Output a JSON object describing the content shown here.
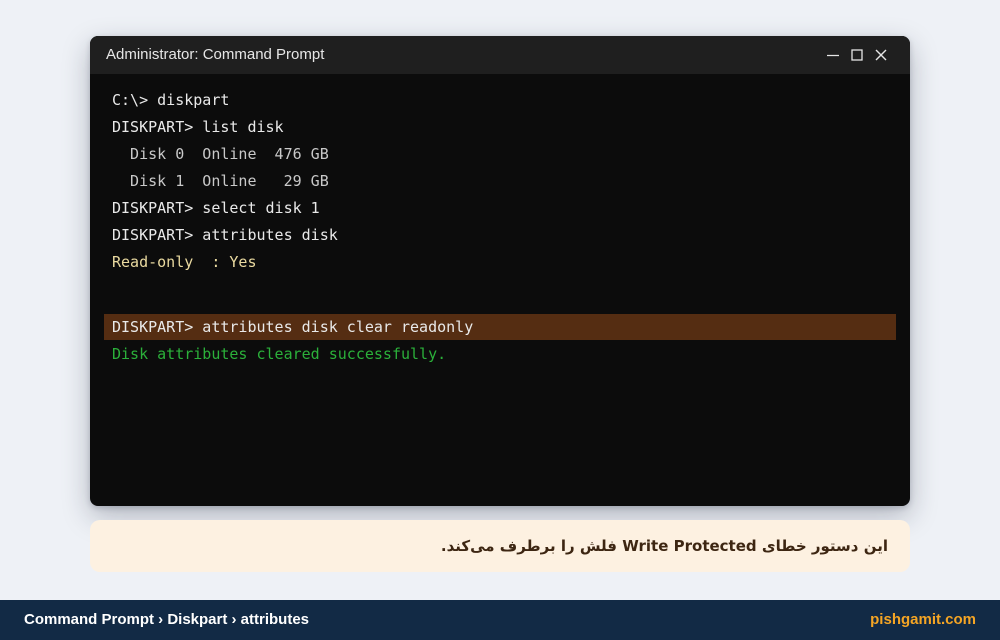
{
  "window": {
    "title": "Administrator: Command Prompt",
    "controls": [
      "minimize-icon",
      "maximize-icon",
      "close-icon"
    ]
  },
  "console": {
    "lines": [
      {
        "text": "C:\\> diskpart",
        "kind": "command"
      },
      {
        "text": "DISKPART> list disk",
        "kind": "command"
      },
      {
        "text": "  Disk 0  Online  476 GB",
        "kind": "output"
      },
      {
        "text": "  Disk 1  Online   29 GB",
        "kind": "output"
      },
      {
        "text": "DISKPART> select disk 1",
        "kind": "command"
      },
      {
        "text": "DISKPART> attributes disk",
        "kind": "command"
      },
      {
        "text": "Read-only  : Yes",
        "kind": "attribute"
      },
      {
        "text": "DISKPART> attributes disk clear readonly",
        "kind": "command-highlighted"
      },
      {
        "text": "Disk attributes cleared successfully.",
        "kind": "success"
      }
    ]
  },
  "caption": {
    "text": "این دستور خطای Write Protected فلش را برطرف می‌کند."
  },
  "footer": {
    "breadcrumb": "Command Prompt › Diskpart › attributes",
    "site": "pishgamit.com"
  },
  "colors": {
    "page_background": "#eef1f6",
    "terminal_background": "#0c0c0c",
    "titlebar_background": "#1f1f1f",
    "highlight": "#552d12",
    "success_text": "#2bb03a",
    "attribute_text": "#eadaa0",
    "caption_background": "#fdf1e1",
    "footer_background": "#122a45",
    "site_accent": "#f5a524"
  }
}
